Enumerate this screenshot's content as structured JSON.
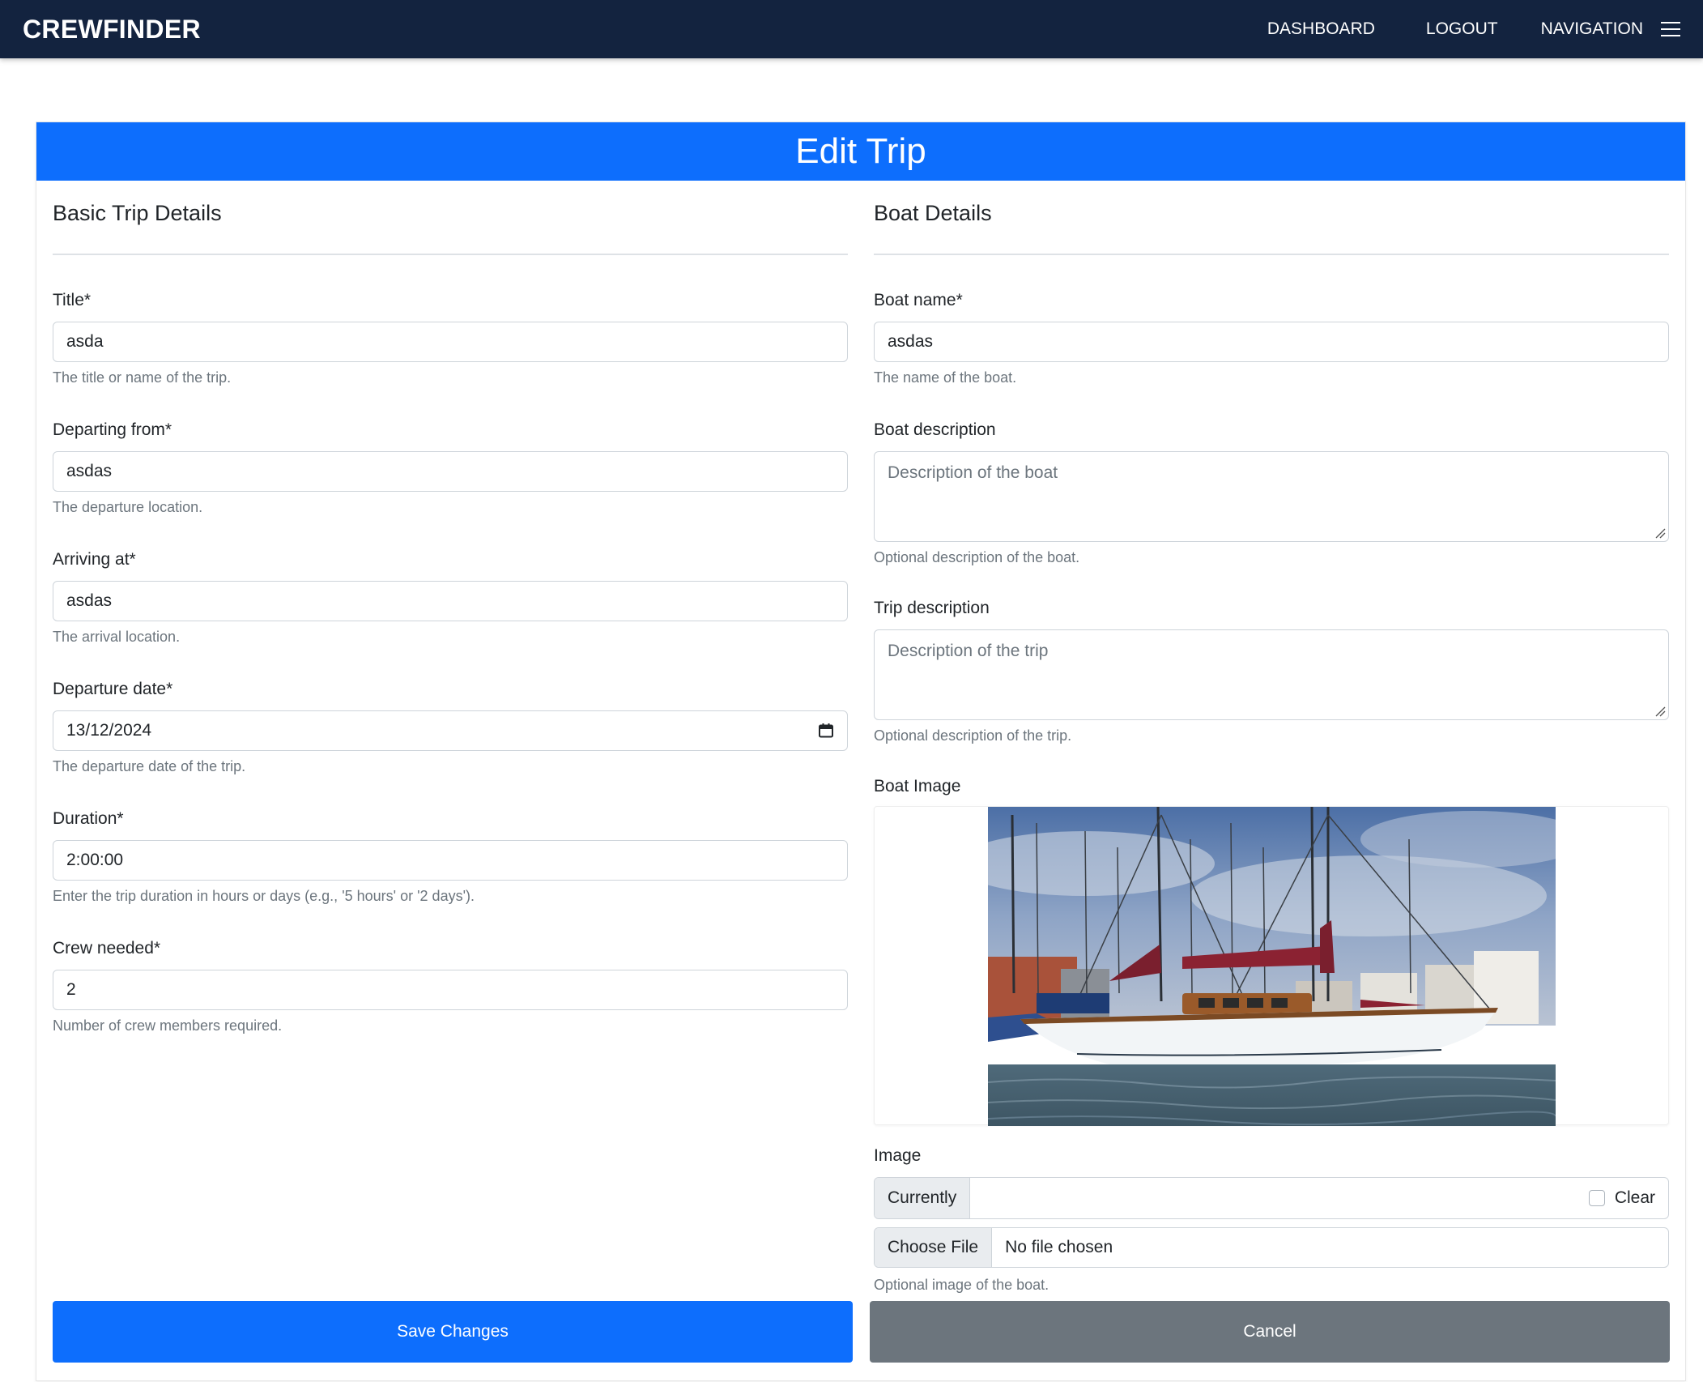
{
  "nav": {
    "brand": "CREWFINDER",
    "links": [
      "DASHBOARD",
      "LOGOUT"
    ],
    "toggle_label": "NAVIGATION",
    "toggle_icon": "hamburger-menu-icon",
    "bg_color": "#13233f"
  },
  "card": {
    "title": "Edit Trip",
    "header_color": "#0d6efd"
  },
  "basic": {
    "section_title": "Basic Trip Details",
    "fields": [
      {
        "label": "Title*",
        "value": "asda",
        "help": "The title or name of the trip."
      },
      {
        "label": "Departing from*",
        "value": "asdas",
        "help": "The departure location."
      },
      {
        "label": "Arriving at*",
        "value": "asdas",
        "help": "The arrival location."
      },
      {
        "label": "Departure date*",
        "value": "13/12/2024",
        "help": "The departure date of the trip."
      },
      {
        "label": "Duration*",
        "value": "2:00:00",
        "help": "Enter the trip duration in hours or days (e.g., '5 hours' or '2 days')."
      },
      {
        "label": "Crew needed*",
        "value": "2",
        "help": "Number of crew members required."
      }
    ]
  },
  "boat": {
    "section_title": "Boat Details",
    "name": {
      "label": "Boat name*",
      "value": "asdas",
      "help": "The name of the boat."
    },
    "boat_description": {
      "label": "Boat description",
      "placeholder": "Description of the boat",
      "help": "Optional description of the boat."
    },
    "trip_description": {
      "label": "Trip description",
      "placeholder": "Description of the trip",
      "help": "Optional description of the trip."
    },
    "image_label": "Boat Image",
    "image_field": {
      "label": "Image",
      "currently_label": "Currently",
      "clear_label": "Clear",
      "choose_file_label": "Choose File",
      "file_status": "No file chosen",
      "help": "Optional image of the boat."
    }
  },
  "actions": {
    "save_label": "Save Changes",
    "cancel_label": "Cancel",
    "save_color": "#0d6efd",
    "cancel_color": "#6c757d"
  }
}
